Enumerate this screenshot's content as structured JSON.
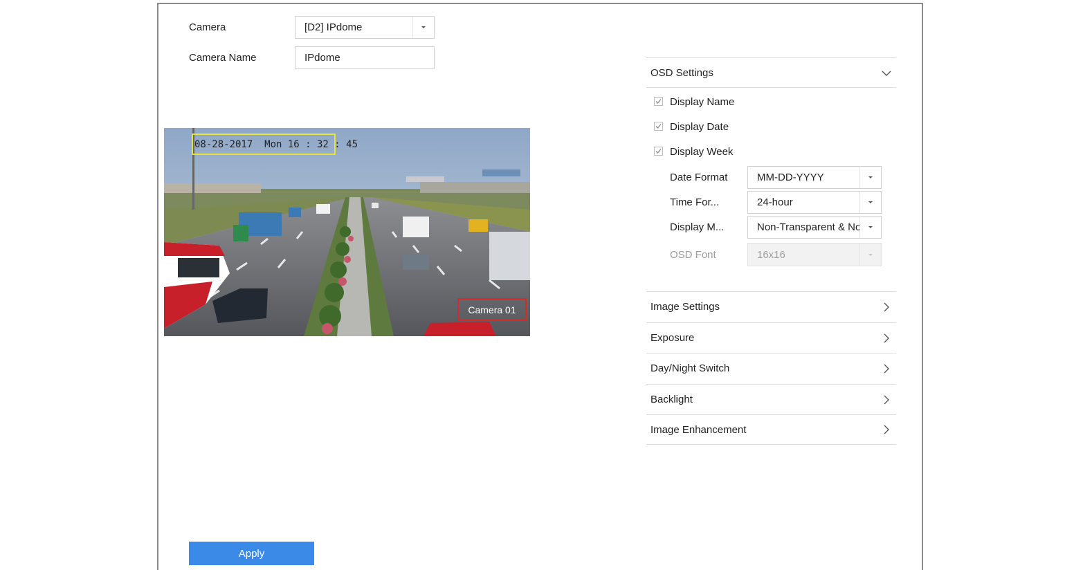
{
  "camera": {
    "label": "Camera",
    "value": "[D2] IPdome"
  },
  "camera_name": {
    "label": "Camera Name",
    "value": "IPdome"
  },
  "preview": {
    "osd_datetime": "08-28-2017  Mon 16 : 32 : 45",
    "osd_camera_name": "Camera 01",
    "colors": {
      "date_box": "#e8e23a",
      "name_box": "#d42a2a"
    }
  },
  "osd_settings": {
    "title": "OSD Settings",
    "expanded": true,
    "checkboxes": [
      {
        "label": "Display Name",
        "checked": true
      },
      {
        "label": "Display Date",
        "checked": true
      },
      {
        "label": "Display Week",
        "checked": true
      }
    ],
    "date_format": {
      "label": "Date Format",
      "value": "MM-DD-YYYY"
    },
    "time_format": {
      "label": "Time For...",
      "value": "24-hour"
    },
    "display_mode": {
      "label": "Display M...",
      "value": "Non-Transparent & No"
    },
    "osd_font": {
      "label": "OSD Font",
      "value": "16x16",
      "disabled": true
    }
  },
  "sections": [
    {
      "label": "Image Settings"
    },
    {
      "label": "Exposure"
    },
    {
      "label": "Day/Night Switch"
    },
    {
      "label": "Backlight"
    },
    {
      "label": "Image Enhancement"
    }
  ],
  "apply_label": "Apply",
  "colors": {
    "accent": "#3c8ae8",
    "border": "#dcdcdc"
  }
}
